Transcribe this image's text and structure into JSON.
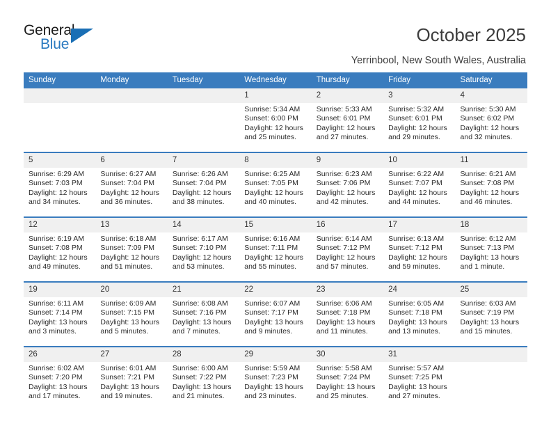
{
  "brand": {
    "name_part1": "General",
    "name_part2": "Blue",
    "accent_color": "#2a7ac0"
  },
  "header": {
    "title": "October 2025",
    "subtitle": "Yerrinbool, New South Wales, Australia"
  },
  "calendar": {
    "header_bg": "#3a7cbe",
    "daynum_bg": "#f0f0f0",
    "weekdays": [
      "Sunday",
      "Monday",
      "Tuesday",
      "Wednesday",
      "Thursday",
      "Friday",
      "Saturday"
    ],
    "weeks": [
      [
        {
          "day": "",
          "sunrise": "",
          "sunset": "",
          "daylight1": "",
          "daylight2": ""
        },
        {
          "day": "",
          "sunrise": "",
          "sunset": "",
          "daylight1": "",
          "daylight2": ""
        },
        {
          "day": "",
          "sunrise": "",
          "sunset": "",
          "daylight1": "",
          "daylight2": ""
        },
        {
          "day": "1",
          "sunrise": "Sunrise: 5:34 AM",
          "sunset": "Sunset: 6:00 PM",
          "daylight1": "Daylight: 12 hours",
          "daylight2": "and 25 minutes."
        },
        {
          "day": "2",
          "sunrise": "Sunrise: 5:33 AM",
          "sunset": "Sunset: 6:01 PM",
          "daylight1": "Daylight: 12 hours",
          "daylight2": "and 27 minutes."
        },
        {
          "day": "3",
          "sunrise": "Sunrise: 5:32 AM",
          "sunset": "Sunset: 6:01 PM",
          "daylight1": "Daylight: 12 hours",
          "daylight2": "and 29 minutes."
        },
        {
          "day": "4",
          "sunrise": "Sunrise: 5:30 AM",
          "sunset": "Sunset: 6:02 PM",
          "daylight1": "Daylight: 12 hours",
          "daylight2": "and 32 minutes."
        }
      ],
      [
        {
          "day": "5",
          "sunrise": "Sunrise: 6:29 AM",
          "sunset": "Sunset: 7:03 PM",
          "daylight1": "Daylight: 12 hours",
          "daylight2": "and 34 minutes."
        },
        {
          "day": "6",
          "sunrise": "Sunrise: 6:27 AM",
          "sunset": "Sunset: 7:04 PM",
          "daylight1": "Daylight: 12 hours",
          "daylight2": "and 36 minutes."
        },
        {
          "day": "7",
          "sunrise": "Sunrise: 6:26 AM",
          "sunset": "Sunset: 7:04 PM",
          "daylight1": "Daylight: 12 hours",
          "daylight2": "and 38 minutes."
        },
        {
          "day": "8",
          "sunrise": "Sunrise: 6:25 AM",
          "sunset": "Sunset: 7:05 PM",
          "daylight1": "Daylight: 12 hours",
          "daylight2": "and 40 minutes."
        },
        {
          "day": "9",
          "sunrise": "Sunrise: 6:23 AM",
          "sunset": "Sunset: 7:06 PM",
          "daylight1": "Daylight: 12 hours",
          "daylight2": "and 42 minutes."
        },
        {
          "day": "10",
          "sunrise": "Sunrise: 6:22 AM",
          "sunset": "Sunset: 7:07 PM",
          "daylight1": "Daylight: 12 hours",
          "daylight2": "and 44 minutes."
        },
        {
          "day": "11",
          "sunrise": "Sunrise: 6:21 AM",
          "sunset": "Sunset: 7:08 PM",
          "daylight1": "Daylight: 12 hours",
          "daylight2": "and 46 minutes."
        }
      ],
      [
        {
          "day": "12",
          "sunrise": "Sunrise: 6:19 AM",
          "sunset": "Sunset: 7:08 PM",
          "daylight1": "Daylight: 12 hours",
          "daylight2": "and 49 minutes."
        },
        {
          "day": "13",
          "sunrise": "Sunrise: 6:18 AM",
          "sunset": "Sunset: 7:09 PM",
          "daylight1": "Daylight: 12 hours",
          "daylight2": "and 51 minutes."
        },
        {
          "day": "14",
          "sunrise": "Sunrise: 6:17 AM",
          "sunset": "Sunset: 7:10 PM",
          "daylight1": "Daylight: 12 hours",
          "daylight2": "and 53 minutes."
        },
        {
          "day": "15",
          "sunrise": "Sunrise: 6:16 AM",
          "sunset": "Sunset: 7:11 PM",
          "daylight1": "Daylight: 12 hours",
          "daylight2": "and 55 minutes."
        },
        {
          "day": "16",
          "sunrise": "Sunrise: 6:14 AM",
          "sunset": "Sunset: 7:12 PM",
          "daylight1": "Daylight: 12 hours",
          "daylight2": "and 57 minutes."
        },
        {
          "day": "17",
          "sunrise": "Sunrise: 6:13 AM",
          "sunset": "Sunset: 7:12 PM",
          "daylight1": "Daylight: 12 hours",
          "daylight2": "and 59 minutes."
        },
        {
          "day": "18",
          "sunrise": "Sunrise: 6:12 AM",
          "sunset": "Sunset: 7:13 PM",
          "daylight1": "Daylight: 13 hours",
          "daylight2": "and 1 minute."
        }
      ],
      [
        {
          "day": "19",
          "sunrise": "Sunrise: 6:11 AM",
          "sunset": "Sunset: 7:14 PM",
          "daylight1": "Daylight: 13 hours",
          "daylight2": "and 3 minutes."
        },
        {
          "day": "20",
          "sunrise": "Sunrise: 6:09 AM",
          "sunset": "Sunset: 7:15 PM",
          "daylight1": "Daylight: 13 hours",
          "daylight2": "and 5 minutes."
        },
        {
          "day": "21",
          "sunrise": "Sunrise: 6:08 AM",
          "sunset": "Sunset: 7:16 PM",
          "daylight1": "Daylight: 13 hours",
          "daylight2": "and 7 minutes."
        },
        {
          "day": "22",
          "sunrise": "Sunrise: 6:07 AM",
          "sunset": "Sunset: 7:17 PM",
          "daylight1": "Daylight: 13 hours",
          "daylight2": "and 9 minutes."
        },
        {
          "day": "23",
          "sunrise": "Sunrise: 6:06 AM",
          "sunset": "Sunset: 7:18 PM",
          "daylight1": "Daylight: 13 hours",
          "daylight2": "and 11 minutes."
        },
        {
          "day": "24",
          "sunrise": "Sunrise: 6:05 AM",
          "sunset": "Sunset: 7:18 PM",
          "daylight1": "Daylight: 13 hours",
          "daylight2": "and 13 minutes."
        },
        {
          "day": "25",
          "sunrise": "Sunrise: 6:03 AM",
          "sunset": "Sunset: 7:19 PM",
          "daylight1": "Daylight: 13 hours",
          "daylight2": "and 15 minutes."
        }
      ],
      [
        {
          "day": "26",
          "sunrise": "Sunrise: 6:02 AM",
          "sunset": "Sunset: 7:20 PM",
          "daylight1": "Daylight: 13 hours",
          "daylight2": "and 17 minutes."
        },
        {
          "day": "27",
          "sunrise": "Sunrise: 6:01 AM",
          "sunset": "Sunset: 7:21 PM",
          "daylight1": "Daylight: 13 hours",
          "daylight2": "and 19 minutes."
        },
        {
          "day": "28",
          "sunrise": "Sunrise: 6:00 AM",
          "sunset": "Sunset: 7:22 PM",
          "daylight1": "Daylight: 13 hours",
          "daylight2": "and 21 minutes."
        },
        {
          "day": "29",
          "sunrise": "Sunrise: 5:59 AM",
          "sunset": "Sunset: 7:23 PM",
          "daylight1": "Daylight: 13 hours",
          "daylight2": "and 23 minutes."
        },
        {
          "day": "30",
          "sunrise": "Sunrise: 5:58 AM",
          "sunset": "Sunset: 7:24 PM",
          "daylight1": "Daylight: 13 hours",
          "daylight2": "and 25 minutes."
        },
        {
          "day": "31",
          "sunrise": "Sunrise: 5:57 AM",
          "sunset": "Sunset: 7:25 PM",
          "daylight1": "Daylight: 13 hours",
          "daylight2": "and 27 minutes."
        },
        {
          "day": "",
          "sunrise": "",
          "sunset": "",
          "daylight1": "",
          "daylight2": ""
        }
      ]
    ]
  }
}
